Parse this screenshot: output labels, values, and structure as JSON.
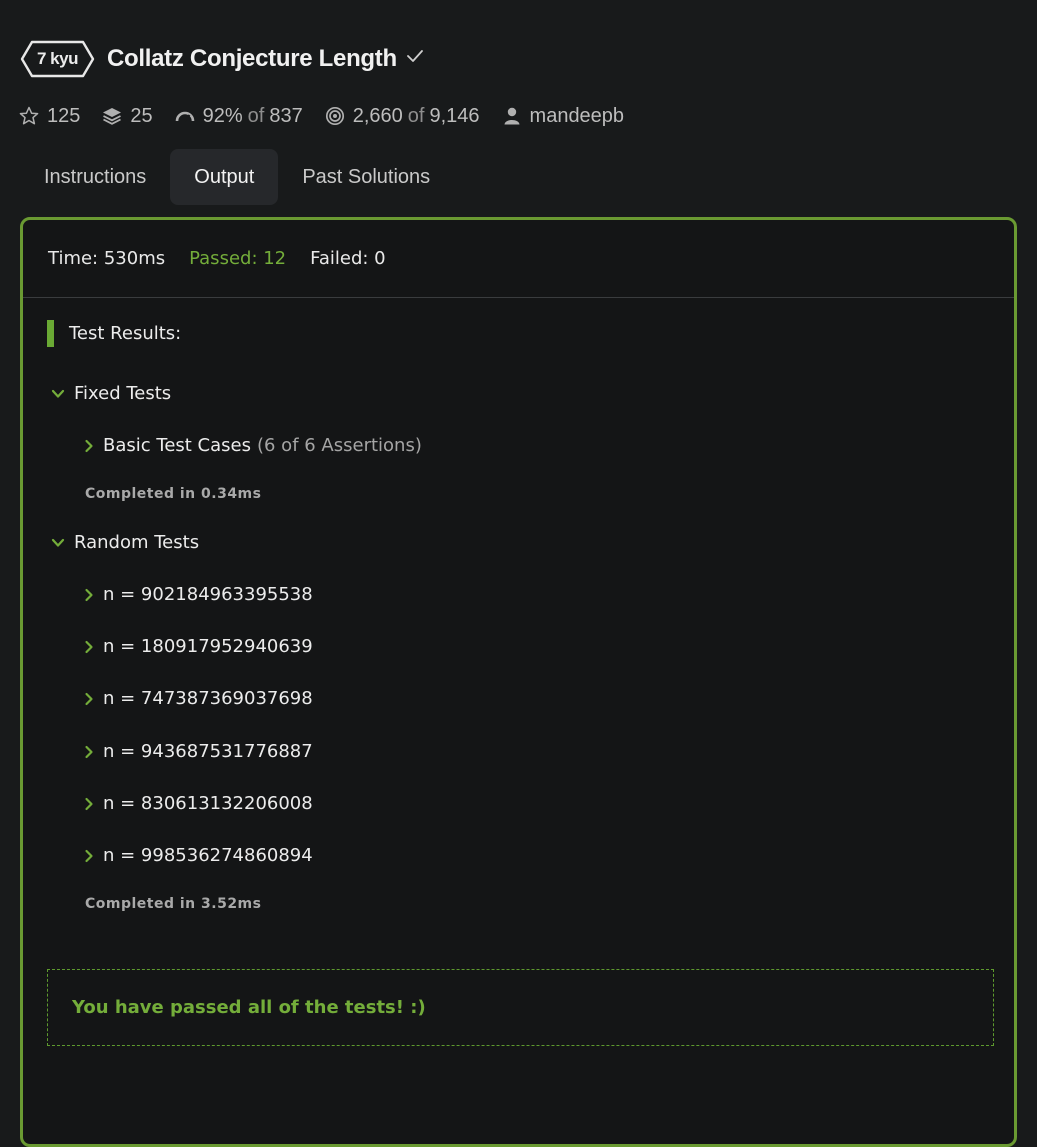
{
  "kata": {
    "rank": "7 kyu",
    "title": "Collatz Conjecture Length"
  },
  "stats": {
    "stars": "125",
    "collections": "25",
    "satisfaction_percent": "92%",
    "satisfaction_of": "of",
    "satisfaction_votes": "837",
    "completed": "2,660",
    "completed_of": "of",
    "attempts": "9,146",
    "author": "mandeepb"
  },
  "tabs": [
    {
      "label": "Instructions",
      "active": false
    },
    {
      "label": "Output",
      "active": true
    },
    {
      "label": "Past Solutions",
      "active": false
    }
  ],
  "summary": {
    "time": "Time: 530ms",
    "passed": "Passed: 12",
    "failed": "Failed: 0"
  },
  "results": {
    "heading": "Test Results:",
    "fixed": {
      "label": "Fixed Tests",
      "cases": [
        {
          "label": "Basic Test Cases",
          "detail": "(6 of 6 Assertions)"
        }
      ],
      "completed": "Completed in 0.34ms"
    },
    "random": {
      "label": "Random Tests",
      "cases": [
        {
          "label": "n = 902184963395538"
        },
        {
          "label": "n = 180917952940639"
        },
        {
          "label": "n = 747387369037698"
        },
        {
          "label": "n = 943687531776887"
        },
        {
          "label": "n = 830613132206008"
        },
        {
          "label": "n = 998536274860894"
        }
      ],
      "completed": "Completed in 3.52ms"
    },
    "final_message": "You have passed all of the tests! :)"
  },
  "colors": {
    "accent_green": "#74ad3a",
    "panel_border": "#6a9a32",
    "background": "#181a1b"
  },
  "icons": {
    "rank": "hexagon-badge",
    "completed_check": "check-icon",
    "stars": "star-icon",
    "collections": "layers-icon",
    "satisfaction": "gauge-icon",
    "completions": "target-icon",
    "author": "user-icon",
    "expanded": "chevron-down-icon",
    "collapsed": "chevron-right-icon"
  }
}
